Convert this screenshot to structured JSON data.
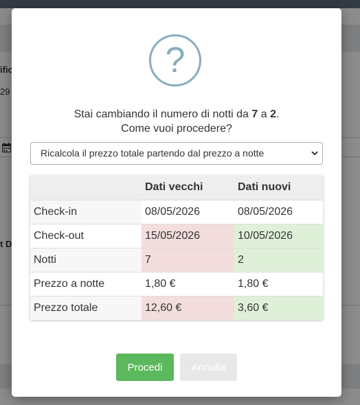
{
  "background": {
    "text1": "ific",
    "text2": "29",
    "text3": "t D."
  },
  "dialog": {
    "icon": "question-circle-icon",
    "message": {
      "prefix": "Stai cambiando il numero di notti da ",
      "old_nights": "7",
      "middle": " a ",
      "new_nights": "2",
      "suffix": ".",
      "line2": "Come vuoi procedere?"
    },
    "select": {
      "selected": "Ricalcola il prezzo totale partendo dal prezzo a notte"
    },
    "table": {
      "headers": [
        "",
        "Dati vecchi",
        "Dati nuovi"
      ],
      "rows": [
        {
          "label": "Check-in",
          "old": "08/05/2026",
          "new": "08/05/2026",
          "changed": false
        },
        {
          "label": "Check-out",
          "old": "15/05/2026",
          "new": "10/05/2026",
          "changed": true
        },
        {
          "label": "Notti",
          "old": "7",
          "new": "2",
          "changed": true
        },
        {
          "label": "Prezzo a notte",
          "old": "1,80 €",
          "new": "1,80 €",
          "changed": false
        },
        {
          "label": "Prezzo totale",
          "old": "12,60 €",
          "new": "3,60 €",
          "changed": true
        }
      ]
    },
    "buttons": {
      "proceed": "Procedi",
      "cancel": "Annulla"
    }
  },
  "colors": {
    "proceed": "#5cb85c",
    "old_changed": "#f3dddd",
    "new_changed": "#dff0d8",
    "icon": "#87adbd"
  }
}
